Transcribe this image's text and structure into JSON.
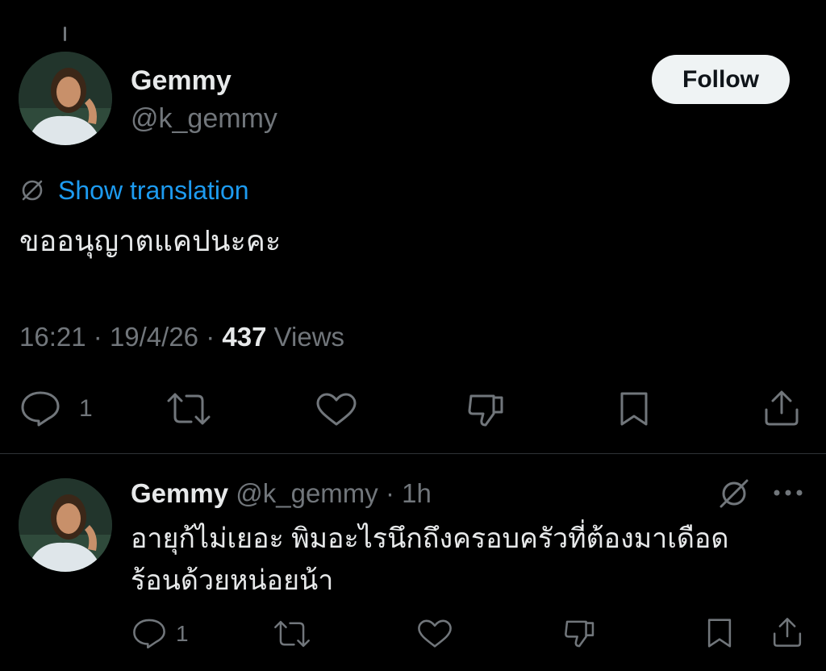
{
  "main_tweet": {
    "author_name": "Gemmy",
    "handle": "@k_gemmy",
    "follow_label": "Follow",
    "show_translation": "Show translation",
    "text": "ขออนุญาตแคปนะคะ",
    "time": "16:21",
    "date": "19/4/26",
    "views_count": "437",
    "views_label": "Views",
    "reply_count": "1"
  },
  "reply_tweet": {
    "author_name": "Gemmy",
    "handle": "@k_gemmy",
    "age": "1h",
    "text_line1": "อายุก้ไม่เยอะ พิมอะไรนึกถึงครอบครัวที่ต้องมาเดือด",
    "text_line2": "ร้อนด้วยหน่อยน้า",
    "reply_count": "1"
  },
  "colors": {
    "background": "#000000",
    "text": "#e7e9ea",
    "muted": "#71767b",
    "link": "#1d9bf0",
    "follow_bg": "#eff3f4",
    "divider": "#2f3336"
  }
}
